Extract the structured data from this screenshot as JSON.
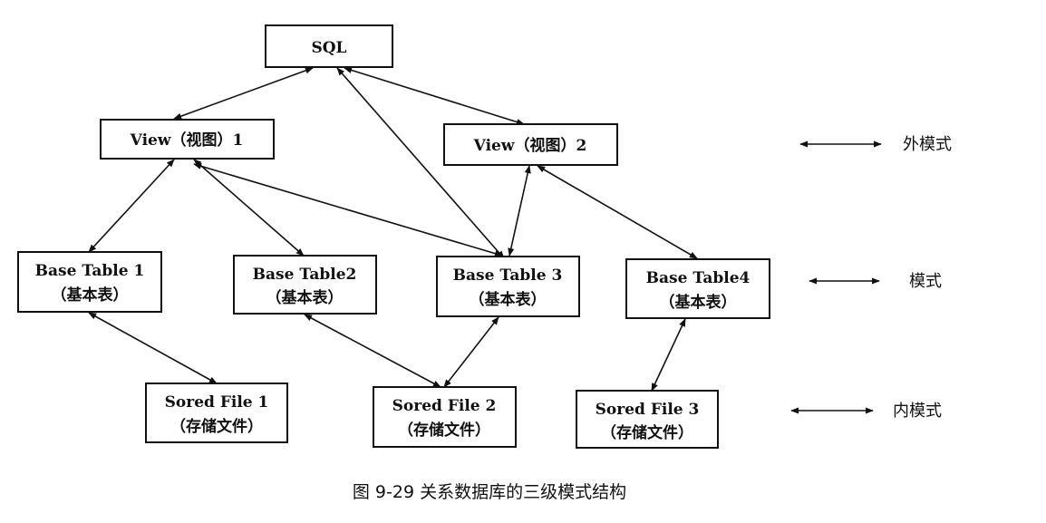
{
  "nodes": {
    "sql": {
      "line1": "SQL"
    },
    "view1": {
      "line1": "View（视图）1"
    },
    "view2": {
      "line1": "View（视图）2"
    },
    "base1": {
      "line1": "Base Table 1",
      "line2": "（基本表）"
    },
    "base2": {
      "line1": "Base Table2",
      "line2": "（基本表）"
    },
    "base3": {
      "line1": "Base Table 3",
      "line2": "（基本表）"
    },
    "base4": {
      "line1": "Base Table4",
      "line2": "（基本表）"
    },
    "file1": {
      "line1": "Sored File 1",
      "line2": "（存储文件）"
    },
    "file2": {
      "line1": "Sored File 2",
      "line2": "（存储文件）"
    },
    "file3": {
      "line1": "Sored File 3",
      "line2": "（存储文件）"
    }
  },
  "legend": {
    "external": "外模式",
    "conceptual": "模式",
    "internal": "内模式"
  },
  "caption": "图 9-29  关系数据库的三级模式结构",
  "colors": {
    "stroke": "#111111",
    "background": "#ffffff"
  }
}
